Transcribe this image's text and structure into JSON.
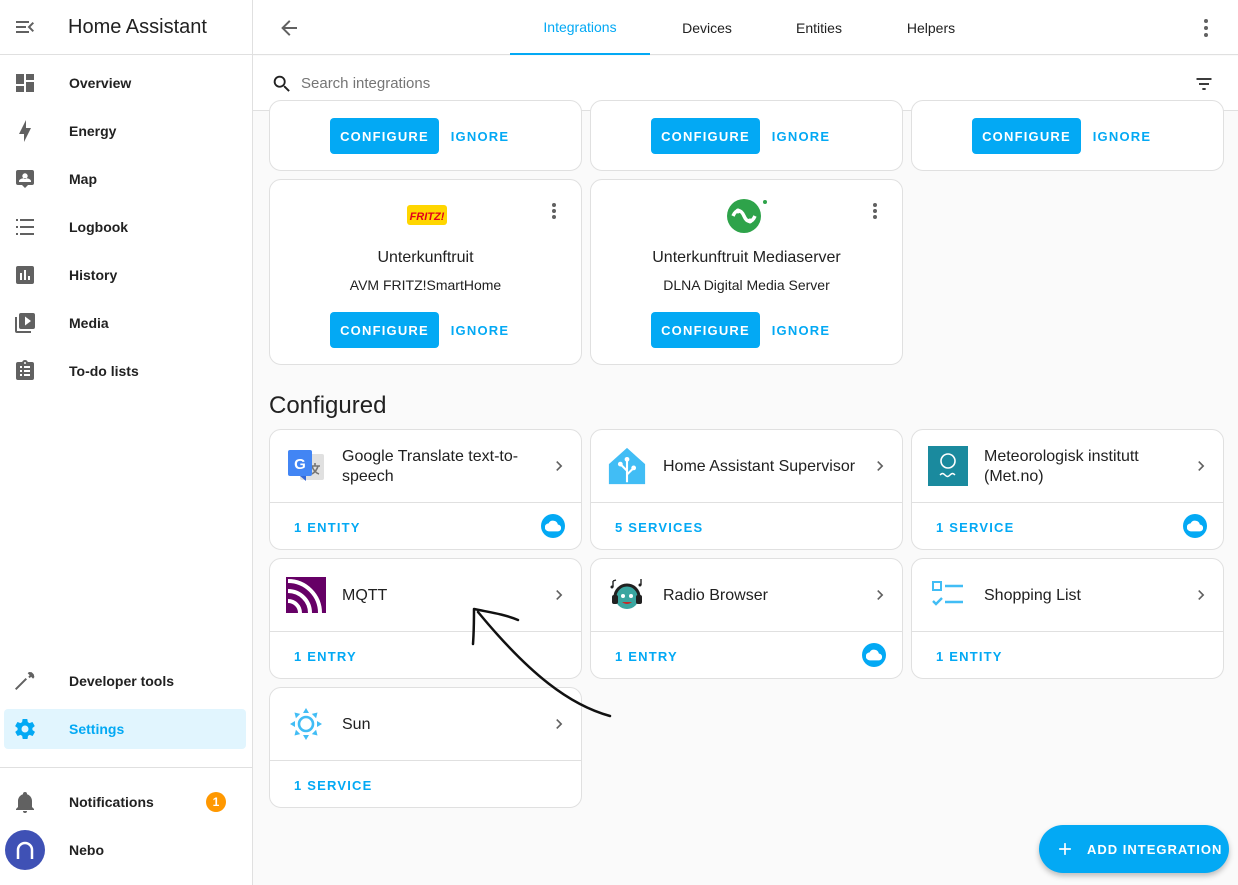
{
  "app": {
    "title": "Home Assistant"
  },
  "sidebar": {
    "items": [
      {
        "label": "Overview",
        "icon": "dashboard-icon"
      },
      {
        "label": "Energy",
        "icon": "lightning-icon"
      },
      {
        "label": "Map",
        "icon": "map-account-icon"
      },
      {
        "label": "Logbook",
        "icon": "list-icon"
      },
      {
        "label": "History",
        "icon": "chart-bar-icon"
      },
      {
        "label": "Media",
        "icon": "play-box-icon"
      },
      {
        "label": "To-do lists",
        "icon": "clipboard-list-icon"
      }
    ],
    "developer_tools": "Developer tools",
    "settings": "Settings",
    "notifications": "Notifications",
    "notifications_count": "1",
    "user": "Nebo"
  },
  "tabs": [
    {
      "label": "Integrations",
      "active": true
    },
    {
      "label": "Devices",
      "active": false
    },
    {
      "label": "Entities",
      "active": false
    },
    {
      "label": "Helpers",
      "active": false
    }
  ],
  "search": {
    "placeholder": "Search integrations",
    "value": ""
  },
  "discovered": {
    "configure_label": "CONFIGURE",
    "ignore_label": "IGNORE",
    "cards": [
      {
        "name": "Unterkunftruit",
        "integration": "AVM FRITZ!SmartHome",
        "logo": "fritz-logo",
        "logo_text": "FRITZ!"
      },
      {
        "name": "Unterkunftruit Mediaserver",
        "integration": "DLNA Digital Media Server",
        "logo": "dlna-logo"
      }
    ]
  },
  "configured": {
    "title": "Configured",
    "cards": [
      {
        "name": "Google Translate text-to-speech",
        "meta": "1 ENTITY",
        "cloud": true,
        "logo": "google-translate-logo"
      },
      {
        "name": "Home Assistant Supervisor",
        "meta": "5 SERVICES",
        "cloud": false,
        "logo": "home-assistant-logo"
      },
      {
        "name": "Meteorologisk institutt (Met.no)",
        "meta": "1 SERVICE",
        "cloud": true,
        "logo": "met-no-logo"
      },
      {
        "name": "MQTT",
        "meta": "1 ENTRY",
        "cloud": false,
        "logo": "mqtt-logo"
      },
      {
        "name": "Radio Browser",
        "meta": "1 ENTRY",
        "cloud": true,
        "logo": "radio-browser-logo"
      },
      {
        "name": "Shopping List",
        "meta": "1 ENTITY",
        "cloud": false,
        "logo": "shopping-list-logo"
      },
      {
        "name": "Sun",
        "meta": "1 SERVICE",
        "cloud": false,
        "logo": "sun-logo"
      }
    ]
  },
  "fab": {
    "label": "ADD INTEGRATION"
  },
  "colors": {
    "accent": "#03a9f4",
    "badge": "#ff9800",
    "avatar": "#3f51b5"
  }
}
